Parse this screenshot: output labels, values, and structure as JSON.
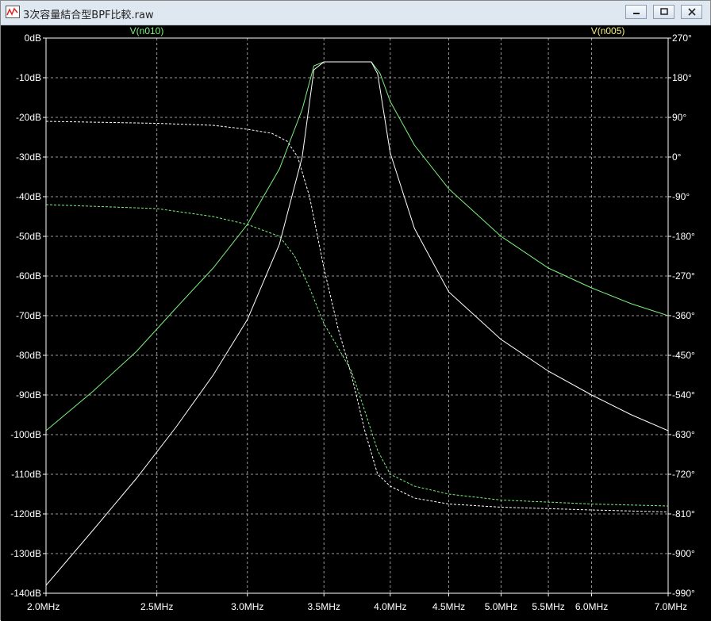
{
  "window": {
    "title": "3次容量結合型BPF比較.raw"
  },
  "chart_data": {
    "type": "line",
    "x_scale": "log",
    "x_tick_labels": [
      "2.0MHz",
      "2.5MHz",
      "3.0MHz",
      "3.5MHz",
      "4.0MHz",
      "4.5MHz",
      "5.0MHz",
      "5.5MHz",
      "6.0MHz",
      "7.0MHz"
    ],
    "x_ticks": [
      2.0,
      2.5,
      3.0,
      3.5,
      4.0,
      4.5,
      5.0,
      5.5,
      6.0,
      7.0
    ],
    "xlim": [
      2.0,
      7.0
    ],
    "y_left_labels": [
      "0dB",
      "-10dB",
      "-20dB",
      "-30dB",
      "-40dB",
      "-50dB",
      "-60dB",
      "-70dB",
      "-80dB",
      "-90dB",
      "-100dB",
      "-110dB",
      "-120dB",
      "-130dB",
      "-140dB"
    ],
    "ylim_left": [
      -140,
      0
    ],
    "y_right_labels": [
      "270°",
      "180°",
      "90°",
      "0°",
      "-90°",
      "-180°",
      "-270°",
      "-360°",
      "-450°",
      "-540°",
      "-630°",
      "-720°",
      "-810°",
      "-900°",
      "-990°"
    ],
    "ylim_right": [
      -990,
      270
    ],
    "grid": true,
    "series": [
      {
        "name": "V(n010)",
        "color": "#7df27d",
        "style": "solid",
        "axis": "left",
        "points": [
          [
            2.0,
            -99
          ],
          [
            2.2,
            -89
          ],
          [
            2.4,
            -79
          ],
          [
            2.6,
            -68
          ],
          [
            2.8,
            -58
          ],
          [
            3.0,
            -47
          ],
          [
            3.2,
            -33
          ],
          [
            3.35,
            -18
          ],
          [
            3.43,
            -7
          ],
          [
            3.5,
            -6
          ],
          [
            3.7,
            -6
          ],
          [
            3.85,
            -6
          ],
          [
            3.92,
            -9
          ],
          [
            4.0,
            -16
          ],
          [
            4.2,
            -27
          ],
          [
            4.5,
            -38
          ],
          [
            5.0,
            -50
          ],
          [
            5.5,
            -58
          ],
          [
            6.0,
            -63
          ],
          [
            6.5,
            -67
          ],
          [
            7.0,
            -70
          ]
        ]
      },
      {
        "name": "V(n005)",
        "color": "#ffffff",
        "style": "solid",
        "axis": "left",
        "points": [
          [
            2.0,
            -138
          ],
          [
            2.2,
            -124
          ],
          [
            2.4,
            -111
          ],
          [
            2.6,
            -98
          ],
          [
            2.8,
            -85
          ],
          [
            3.0,
            -71
          ],
          [
            3.2,
            -52
          ],
          [
            3.35,
            -30
          ],
          [
            3.43,
            -8
          ],
          [
            3.5,
            -6
          ],
          [
            3.7,
            -6
          ],
          [
            3.85,
            -6
          ],
          [
            3.9,
            -9
          ],
          [
            4.0,
            -29
          ],
          [
            4.2,
            -48
          ],
          [
            4.5,
            -64
          ],
          [
            5.0,
            -76
          ],
          [
            5.5,
            -84
          ],
          [
            6.0,
            -90
          ],
          [
            6.5,
            -95
          ],
          [
            7.0,
            -99
          ]
        ]
      },
      {
        "name": "V(n010) phase",
        "color": "#7df27d",
        "style": "dashed",
        "axis": "right",
        "points": [
          [
            2.0,
            -42
          ],
          [
            2.5,
            -43
          ],
          [
            2.8,
            -45
          ],
          [
            3.0,
            -47
          ],
          [
            3.2,
            -50
          ],
          [
            3.3,
            -55
          ],
          [
            3.4,
            -63
          ],
          [
            3.5,
            -72
          ],
          [
            3.6,
            -78
          ],
          [
            3.7,
            -84
          ],
          [
            3.8,
            -94
          ],
          [
            3.9,
            -104
          ],
          [
            4.0,
            -110
          ],
          [
            4.2,
            -113
          ],
          [
            4.5,
            -115
          ],
          [
            5.0,
            -116.5
          ],
          [
            6.0,
            -117.5
          ],
          [
            7.0,
            -118
          ]
        ]
      },
      {
        "name": "V(n005) phase",
        "color": "#ffffff",
        "style": "dashed",
        "axis": "right",
        "points": [
          [
            2.0,
            -21
          ],
          [
            2.5,
            -21.5
          ],
          [
            2.8,
            -22
          ],
          [
            3.0,
            -23
          ],
          [
            3.15,
            -24
          ],
          [
            3.25,
            -26
          ],
          [
            3.32,
            -30
          ],
          [
            3.4,
            -40
          ],
          [
            3.5,
            -58
          ],
          [
            3.6,
            -73
          ],
          [
            3.7,
            -85
          ],
          [
            3.8,
            -99
          ],
          [
            3.9,
            -110
          ],
          [
            4.0,
            -113
          ],
          [
            4.2,
            -116
          ],
          [
            4.5,
            -117.5
          ],
          [
            5.0,
            -118.3
          ],
          [
            6.0,
            -119
          ],
          [
            7.0,
            -119.5
          ]
        ]
      }
    ],
    "legend": [
      {
        "label": "V(n010)",
        "color": "#7df27d"
      },
      {
        "label": "V(n005)",
        "color": "#f5f07a"
      }
    ]
  }
}
